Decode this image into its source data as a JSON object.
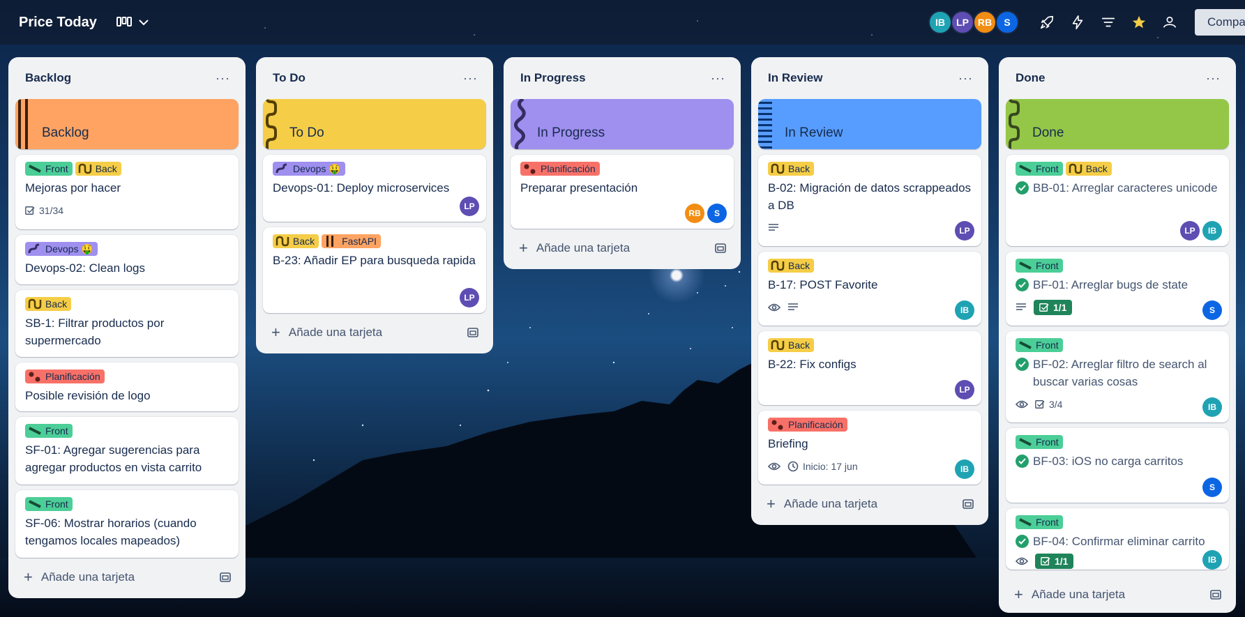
{
  "board": {
    "title": "Price Today"
  },
  "header": {
    "members": [
      {
        "initials": "IB",
        "color": "#1fa3b3"
      },
      {
        "initials": "LP",
        "color": "#5e4db2"
      },
      {
        "initials": "RB",
        "color": "#f18d13"
      },
      {
        "initials": "S",
        "color": "#0c66e4"
      }
    ],
    "share_label": "Compartir"
  },
  "lists": [
    {
      "title": "Backlog",
      "cover": "Backlog",
      "add_label": "Añade una tarjeta",
      "cards": [
        {
          "labels": [
            "Front",
            "Back"
          ],
          "title": "Mejoras por hacer",
          "checklist": "31/34"
        },
        {
          "labels": [
            "Devops 🤑"
          ],
          "title": "Devops-02: Clean logs"
        },
        {
          "labels": [
            "Back"
          ],
          "title": "SB-1: Filtrar productos por supermercado"
        },
        {
          "labels": [
            "Planificación"
          ],
          "title": "Posible revisión de logo"
        },
        {
          "labels": [
            "Front"
          ],
          "title": "SF-01: Agregar sugerencias para agregar productos en vista carrito"
        },
        {
          "labels": [
            "Front"
          ],
          "title": "SF-06: Mostrar horarios (cuando tengamos locales mapeados)"
        }
      ]
    },
    {
      "title": "To Do",
      "cover": "To Do",
      "add_label": "Añade una tarjeta",
      "cards": [
        {
          "labels": [
            "Devops 🤑"
          ],
          "title": "Devops-01: Deploy microservices",
          "members": [
            "LP"
          ]
        },
        {
          "labels": [
            "Back",
            "FastAPI"
          ],
          "title": "B-23: Añadir EP para busqueda rapida",
          "members": [
            "LP"
          ]
        }
      ]
    },
    {
      "title": "In Progress",
      "cover": "In Progress",
      "add_label": "Añade una tarjeta",
      "cards": [
        {
          "labels": [
            "Planificación"
          ],
          "title": "Preparar presentación",
          "members": [
            "RB",
            "S"
          ]
        }
      ]
    },
    {
      "title": "In Review",
      "cover": "In Review",
      "add_label": "Añade una tarjeta",
      "cards": [
        {
          "labels": [
            "Back"
          ],
          "title": "B-02: Migración de datos scrappeados a DB",
          "members": [
            "LP"
          ]
        },
        {
          "labels": [
            "Back"
          ],
          "title": "B-17: POST Favorite",
          "members": [
            "IB"
          ]
        },
        {
          "labels": [
            "Back"
          ],
          "title": "B-22: Fix configs",
          "members": [
            "LP"
          ]
        },
        {
          "labels": [
            "Planificación"
          ],
          "title": "Briefing",
          "start": "Inicio: 17 jun",
          "members": [
            "IB"
          ]
        }
      ]
    },
    {
      "title": "Done",
      "cover": "Done",
      "add_label": "Añade una tarjeta",
      "cards": [
        {
          "labels": [
            "Front",
            "Back"
          ],
          "title": "BB-01: Arreglar caracteres unicode",
          "members": [
            "LP",
            "IB"
          ]
        },
        {
          "labels": [
            "Front"
          ],
          "title": "BF-01: Arreglar bugs de state",
          "checklist": "1/1",
          "members": [
            "S"
          ]
        },
        {
          "labels": [
            "Front"
          ],
          "title": "BF-02: Arreglar filtro de search al buscar varias cosas",
          "checklist": "3/4",
          "members": [
            "IB"
          ]
        },
        {
          "labels": [
            "Front"
          ],
          "title": "BF-03: iOS no carga carritos",
          "members": [
            "S"
          ]
        },
        {
          "labels": [
            "Front"
          ],
          "title": "BF-04: Confirmar eliminar carrito",
          "checklist": "1/1",
          "members": [
            "IB"
          ]
        }
      ]
    }
  ],
  "colors": {
    "backlog": "#fea362",
    "todo": "#f5cd47",
    "inprogress": "#9f8fef",
    "inreview": "#579dff",
    "done": "#94c748",
    "label_front": "#4bce97",
    "label_back": "#f5cd47",
    "label_devops": "#9f8fef",
    "label_plan": "#f87168",
    "label_fastapi": "#fea362"
  }
}
